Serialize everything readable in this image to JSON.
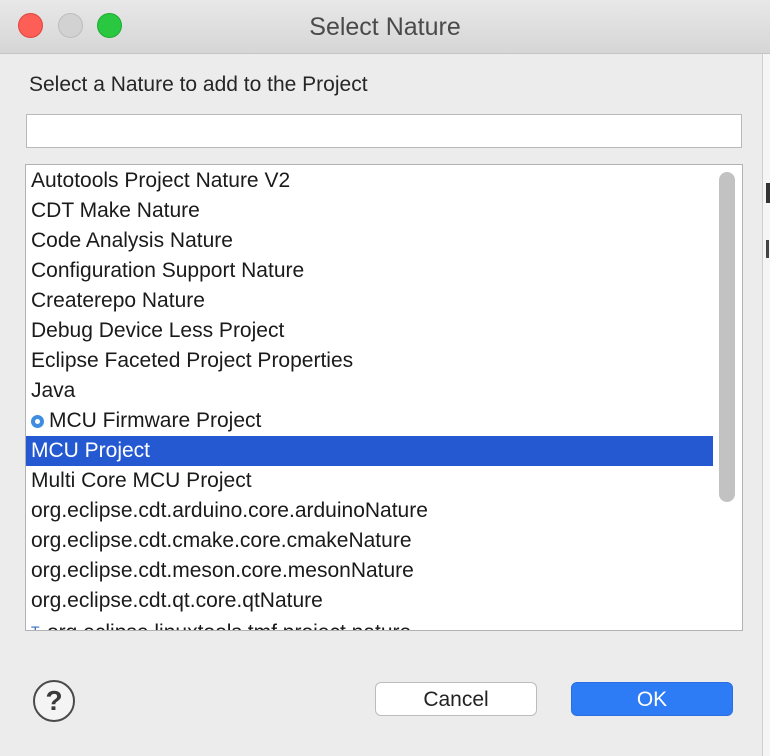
{
  "window": {
    "title": "Select Nature"
  },
  "dialog": {
    "prompt": "Select a Nature to add to the Project",
    "filter": {
      "value": "",
      "placeholder": ""
    },
    "list_items": [
      {
        "label": "Autotools Project Nature V2",
        "icon": ""
      },
      {
        "label": "CDT Make Nature",
        "icon": ""
      },
      {
        "label": "Code Analysis Nature",
        "icon": ""
      },
      {
        "label": "Configuration Support Nature",
        "icon": ""
      },
      {
        "label": "Createrepo Nature",
        "icon": ""
      },
      {
        "label": "Debug Device Less Project",
        "icon": ""
      },
      {
        "label": "Eclipse Faceted Project Properties",
        "icon": ""
      },
      {
        "label": "Java",
        "icon": ""
      },
      {
        "label": "MCU Firmware Project",
        "icon": "mcu-nature-icon"
      },
      {
        "label": "MCU Project",
        "icon": "",
        "selected": true
      },
      {
        "label": "Multi Core MCU Project",
        "icon": ""
      },
      {
        "label": "org.eclipse.cdt.arduino.core.arduinoNature",
        "icon": ""
      },
      {
        "label": "org.eclipse.cdt.cmake.core.cmakeNature",
        "icon": ""
      },
      {
        "label": "org.eclipse.cdt.meson.core.mesonNature",
        "icon": ""
      },
      {
        "label": "org.eclipse.cdt.qt.core.qtNature",
        "icon": ""
      },
      {
        "label": "org.eclipse.linuxtools.tmf.project.nature",
        "icon": "tmf-nature-icon"
      }
    ],
    "help_symbol": "?",
    "cancel_label": "Cancel",
    "ok_label": "OK"
  },
  "colors": {
    "selection": "#2459d1",
    "ok_button": "#2e7bf6",
    "close": "#fd5f57",
    "maximize": "#2ac840"
  }
}
